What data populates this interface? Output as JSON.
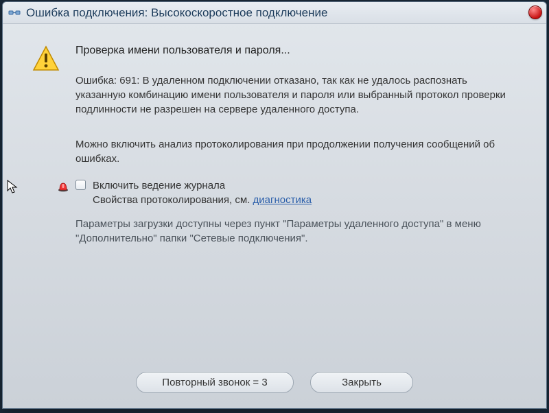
{
  "title": "Ошибка подключения: Высокоскоростное подключение",
  "headline": "Проверка имени пользователя и пароля...",
  "error_body": "Ошибка: 691: В удаленном подключении отказано, так как не удалось распознать указанную комбинацию имени пользователя и пароля или выбранный протокол проверки подлинности не разрешен на сервере удаленного доступа.",
  "analysis_note": "Можно включить анализ протоколирования при продолжении получения сообщений об ошибках.",
  "logging": {
    "checkbox_label": "Включить ведение журнала",
    "properties_prefix": "Свойства протоколирования, см. ",
    "link_text": "диагностика"
  },
  "params_hint": "Параметры загрузки доступны через пункт \"Параметры удаленного доступа\" в меню \"Дополнительно\" папки \"Сетевые подключения\".",
  "buttons": {
    "retry": "Повторный звонок = 3",
    "close": "Закрыть"
  }
}
